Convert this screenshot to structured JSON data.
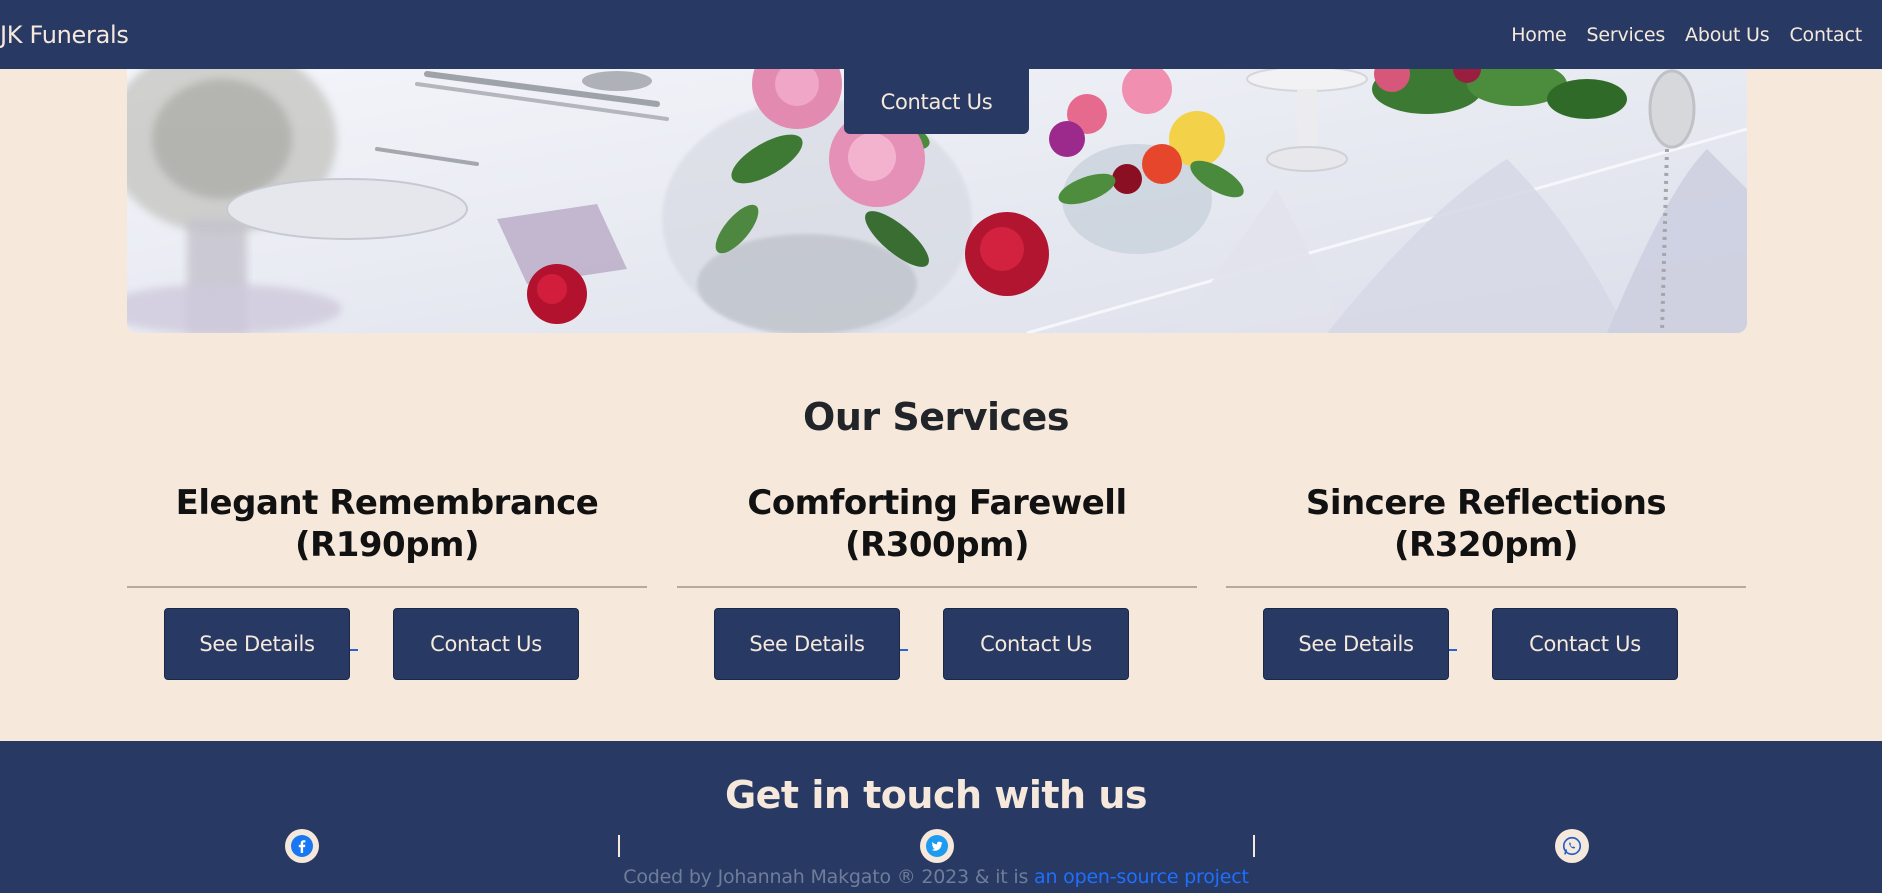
{
  "navbar": {
    "brand": "JK Funerals",
    "links": [
      "Home",
      "Services",
      "About Us",
      "Contact"
    ]
  },
  "hero": {
    "cta_label": "Contact Us"
  },
  "services": {
    "title": "Our Services",
    "items": [
      {
        "name_line1": "Elegant Remembrance",
        "name_line2": "(R190pm)",
        "details_label": "See Details",
        "contact_label": "Contact Us"
      },
      {
        "name_line1": "Comforting Farewell",
        "name_line2": "(R300pm)",
        "details_label": "See Details",
        "contact_label": "Contact Us"
      },
      {
        "name_line1": "Sincere Reflections",
        "name_line2": "(R320pm)",
        "details_label": "See Details",
        "contact_label": "Contact Us"
      }
    ]
  },
  "footer": {
    "title": "Get in touch with us",
    "socials": [
      "facebook-icon",
      "twitter-icon",
      "whatsapp-icon"
    ],
    "separator": "|",
    "credit_text": "Coded by Johannah Makgato ® 2023 & it is ",
    "credit_link": "an open-source project"
  },
  "colors": {
    "navy": "#283a63",
    "cream": "#f6e9dc",
    "link_blue": "#1f6fff"
  }
}
